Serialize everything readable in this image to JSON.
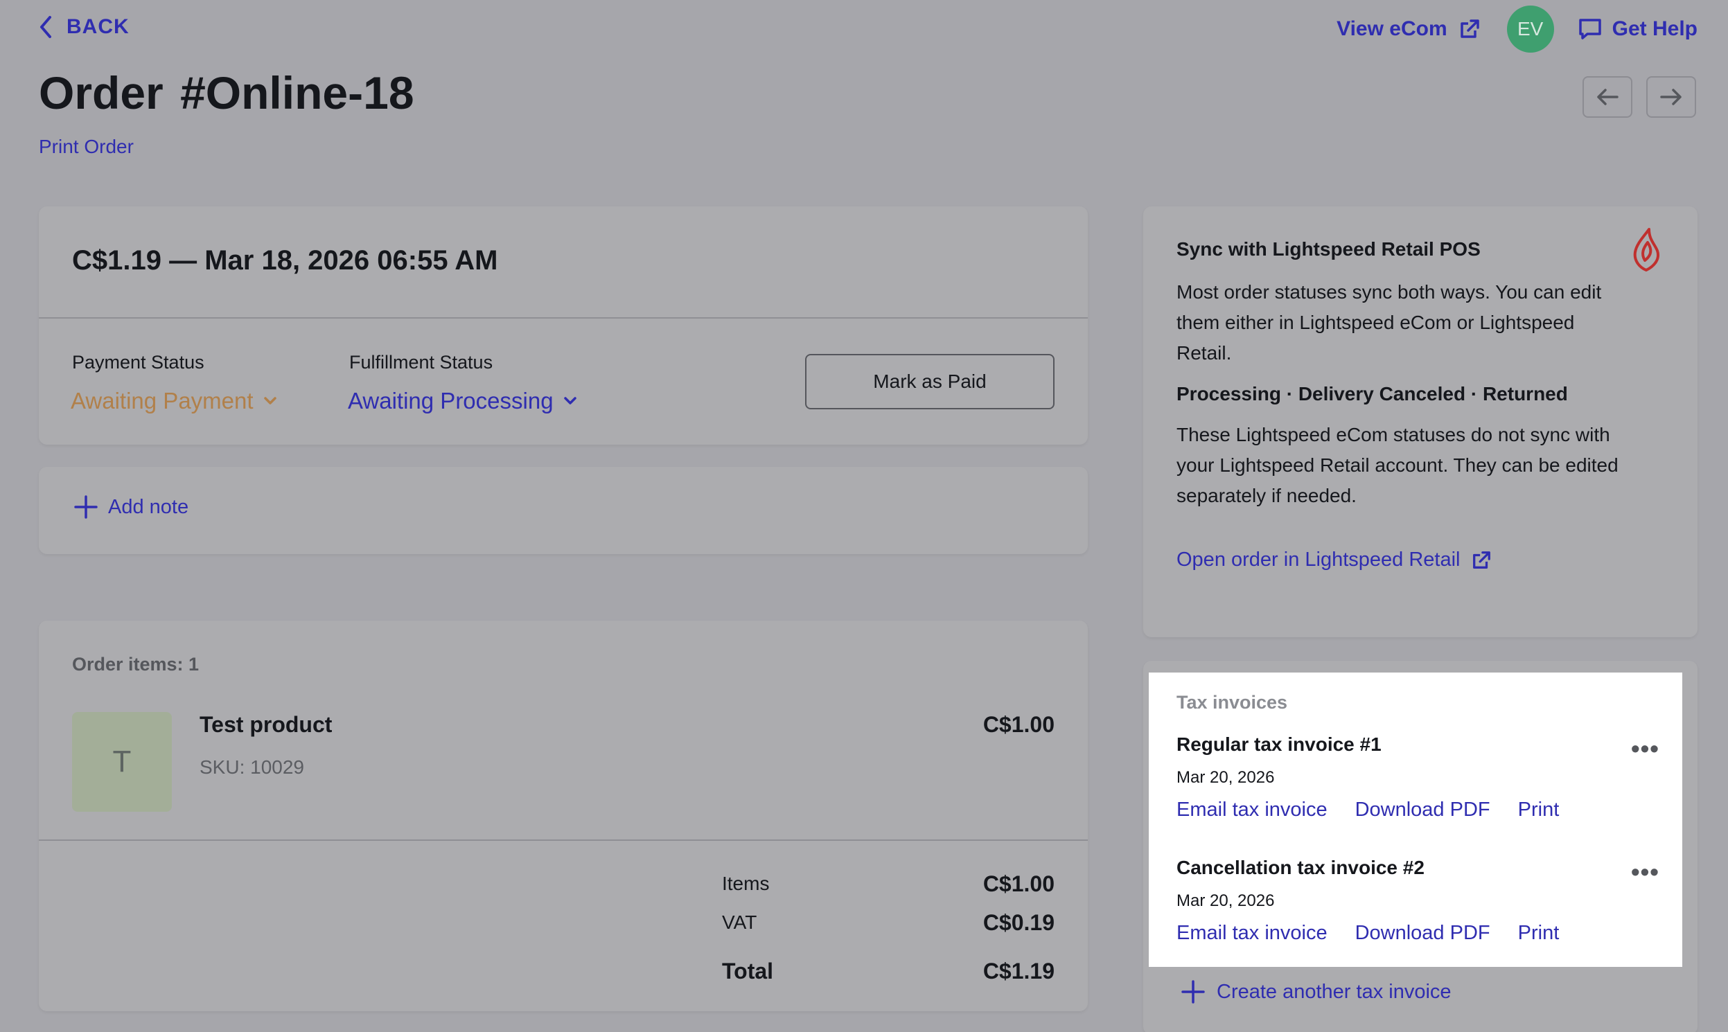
{
  "header": {
    "back_label": "BACK",
    "view_ecom_label": "View eCom",
    "avatar_initials": "EV",
    "help_label": "Get Help",
    "order_label": "Order",
    "order_number": "#Online-18",
    "print_order_label": "Print Order"
  },
  "summary": {
    "headline": "C$1.19 — Mar 18, 2026 06:55 AM",
    "payment_status_label": "Payment Status",
    "payment_status_value": "Awaiting Payment",
    "fulfillment_status_label": "Fulfillment Status",
    "fulfillment_status_value": "Awaiting Processing",
    "mark_paid_label": "Mark as Paid"
  },
  "notes": {
    "add_note_label": "Add note"
  },
  "items": {
    "title": "Order items: 1",
    "list": [
      {
        "thumb_letter": "T",
        "name": "Test product",
        "sku": "SKU: 10029",
        "price": "C$1.00"
      }
    ],
    "totals": [
      {
        "label": "Items",
        "value": "C$1.00"
      },
      {
        "label": "VAT",
        "value": "C$0.19"
      },
      {
        "label": "Total",
        "value": "C$1.19"
      }
    ]
  },
  "sync": {
    "title": "Sync with Lightspeed Retail POS",
    "paragraph1": "Most order statuses sync both ways. You can edit them either in Lightspeed eCom or Lightspeed Retail.",
    "subtitle": "Processing · Delivery Canceled · Returned",
    "paragraph2": "These Lightspeed eCom statuses do not sync with your Lightspeed Retail account. They can be edited separately if needed.",
    "open_link": "Open order in Lightspeed Retail"
  },
  "tax_invoices": {
    "heading": "Tax invoices",
    "list": [
      {
        "name": "Regular tax invoice #1",
        "date": "Mar 20, 2026",
        "email": "Email tax invoice",
        "download": "Download PDF",
        "print": "Print"
      },
      {
        "name": "Cancellation tax invoice #2",
        "date": "Mar 20, 2026",
        "email": "Email tax invoice",
        "download": "Download PDF",
        "print": "Print"
      }
    ],
    "create_label": "Create another tax invoice"
  },
  "colors": {
    "link": "#2f2db0",
    "awaiting_payment": "#b1804a",
    "avatar": "#3f9f6f",
    "logo": "#c0302e",
    "overlay_bg": "#a6a6ab"
  }
}
